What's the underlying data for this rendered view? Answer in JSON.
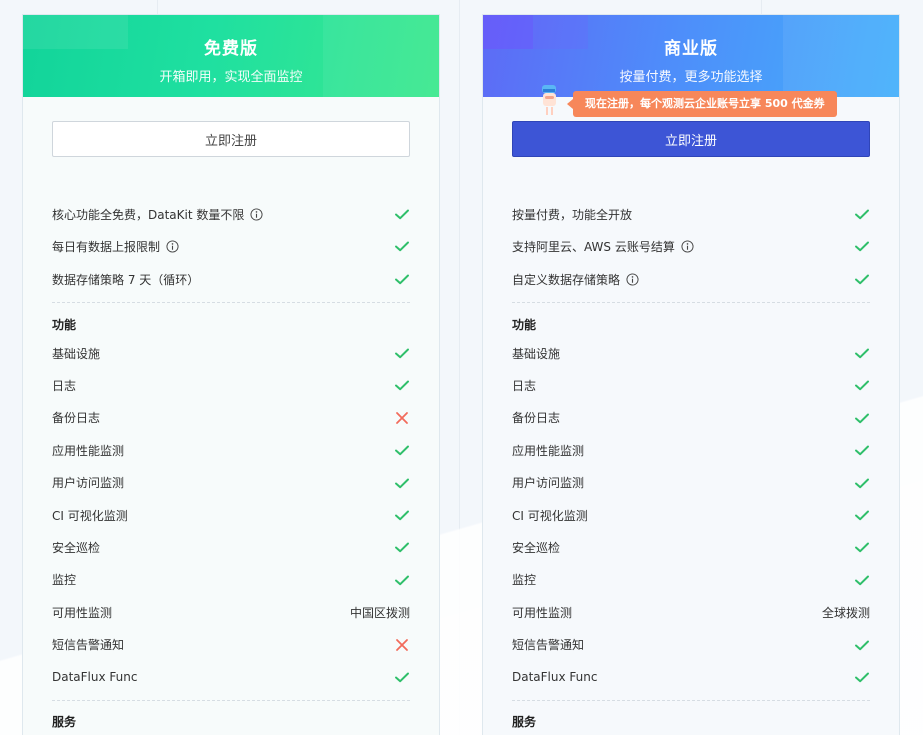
{
  "free": {
    "title": "免费版",
    "subtitle": "开箱即用，实现全面监控",
    "cta": "立即注册",
    "highlights": [
      {
        "label": "核心功能全免费，DataKit 数量不限",
        "info": true,
        "status": "check"
      },
      {
        "label": "每日有数据上报限制",
        "info": true,
        "status": "check"
      },
      {
        "label": "数据存储策略 7 天（循环）",
        "info": false,
        "status": "check"
      }
    ],
    "features_title": "功能",
    "features": [
      {
        "label": "基础设施",
        "status": "check"
      },
      {
        "label": "日志",
        "status": "check"
      },
      {
        "label": "备份日志",
        "status": "cross"
      },
      {
        "label": "应用性能监测",
        "status": "check"
      },
      {
        "label": "用户访问监测",
        "status": "check"
      },
      {
        "label": "CI 可视化监测",
        "status": "check"
      },
      {
        "label": "安全巡检",
        "status": "check"
      },
      {
        "label": "监控",
        "status": "check"
      },
      {
        "label": "可用性监测",
        "status": "text",
        "text": "中国区拨测"
      },
      {
        "label": "短信告警通知",
        "status": "cross"
      },
      {
        "label": "DataFlux Func",
        "status": "check"
      }
    ],
    "services_title": "服务"
  },
  "biz": {
    "title": "商业版",
    "subtitle": "按量付费，更多功能选择",
    "promo": "现在注册，每个观测云企业账号立享 500 代金券",
    "cta": "立即注册",
    "highlights": [
      {
        "label": "按量付费，功能全开放",
        "info": false,
        "status": "check"
      },
      {
        "label": "支持阿里云、AWS 云账号结算",
        "info": true,
        "status": "check"
      },
      {
        "label": "自定义数据存储策略",
        "info": true,
        "status": "check"
      }
    ],
    "features_title": "功能",
    "features": [
      {
        "label": "基础设施",
        "status": "check"
      },
      {
        "label": "日志",
        "status": "check"
      },
      {
        "label": "备份日志",
        "status": "check"
      },
      {
        "label": "应用性能监测",
        "status": "check"
      },
      {
        "label": "用户访问监测",
        "status": "check"
      },
      {
        "label": "CI 可视化监测",
        "status": "check"
      },
      {
        "label": "安全巡检",
        "status": "check"
      },
      {
        "label": "监控",
        "status": "check"
      },
      {
        "label": "可用性监测",
        "status": "text",
        "text": "全球拨测"
      },
      {
        "label": "短信告警通知",
        "status": "check"
      },
      {
        "label": "DataFlux Func",
        "status": "check"
      }
    ],
    "services_title": "服务"
  },
  "colors": {
    "check": "#2fbf6a",
    "cross": "#f26b5b",
    "free_accent": "#1fe0a0",
    "biz_accent": "#3d55d6",
    "promo": "#f7875a"
  }
}
